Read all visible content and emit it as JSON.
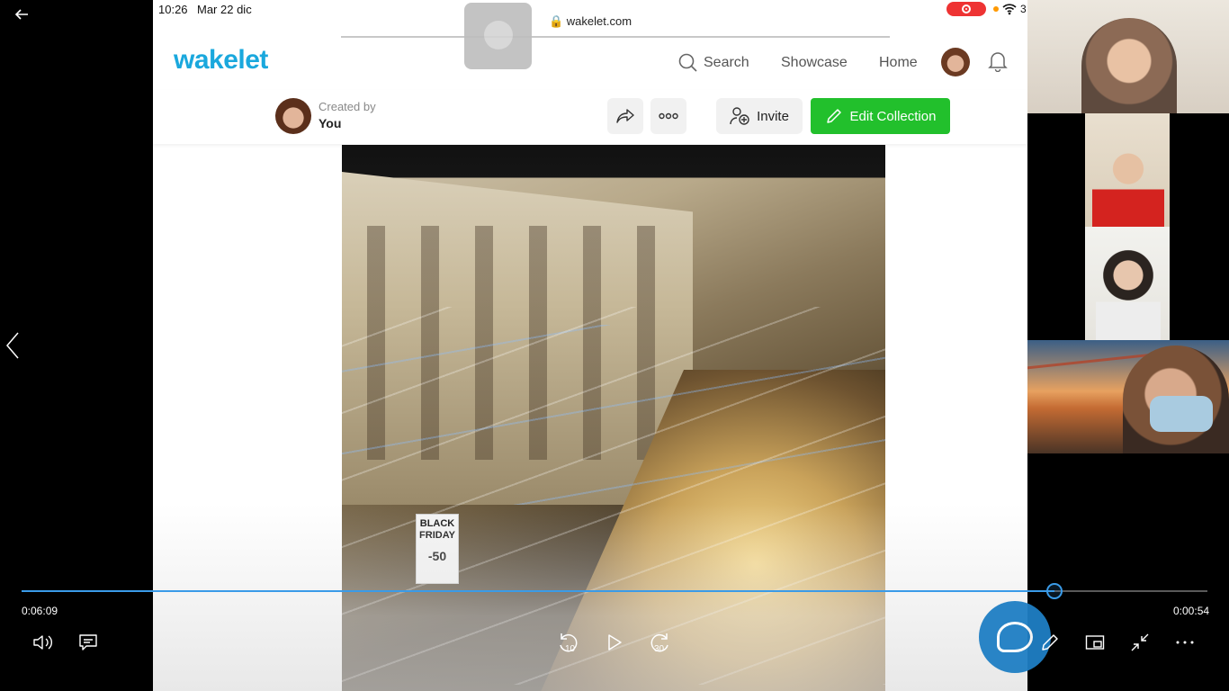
{
  "status_bar": {
    "time": "10:26",
    "date": "Mar 22 dic",
    "battery": "3"
  },
  "browser": {
    "url": "wakelet.com"
  },
  "nav": {
    "logo": "wakelet",
    "search_label": "Search",
    "showcase_label": "Showcase",
    "home_label": "Home"
  },
  "collection": {
    "created_by_label": "Created by",
    "creator_name": "You",
    "invite_label": "Invite",
    "edit_label": "Edit Collection"
  },
  "photo": {
    "sign_text": "BLACK FRIDAY",
    "sign_discount": "-50"
  },
  "player": {
    "elapsed": "0:06:09",
    "remaining": "0:00:54",
    "progress": 0.871,
    "skip_back_label": "10",
    "skip_forward_label": "30"
  },
  "colors": {
    "brand": "#1aa8dd",
    "edit_button": "#22c02c",
    "progress": "#3a9be8",
    "recording": "#e33333"
  },
  "icons": [
    "back-arrow-icon",
    "chevron-left-icon",
    "search-icon",
    "bell-icon",
    "share-icon",
    "more-icon",
    "add-user-icon",
    "pencil-icon",
    "volume-icon",
    "captions-icon",
    "replay-10-icon",
    "play-icon",
    "forward-30-icon",
    "chat-icon",
    "draw-icon",
    "miniplayer-icon",
    "exit-fullscreen-icon",
    "more-options-icon"
  ]
}
